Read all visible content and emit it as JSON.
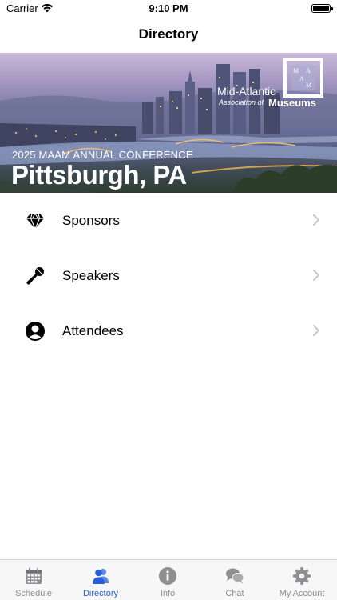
{
  "status_bar": {
    "carrier": "Carrier",
    "time": "9:10 PM",
    "battery_level": 1.0
  },
  "nav": {
    "title": "Directory"
  },
  "banner": {
    "conference": "2025 MAAM ANNUAL CONFERENCE",
    "city": "Pittsburgh, PA",
    "logo_letters": [
      "M",
      "A",
      "A",
      "M"
    ],
    "org_line1": "Mid-Atlantic",
    "org_line2": "Association of",
    "org_line3": "Museums"
  },
  "list": {
    "items": [
      {
        "label": "Sponsors",
        "icon": "diamond-icon"
      },
      {
        "label": "Speakers",
        "icon": "microphone-icon"
      },
      {
        "label": "Attendees",
        "icon": "user-circle-icon"
      }
    ]
  },
  "tabs": {
    "items": [
      {
        "label": "Schedule",
        "icon": "calendar-icon",
        "active": false
      },
      {
        "label": "Directory",
        "icon": "people-icon",
        "active": true
      },
      {
        "label": "Info",
        "icon": "info-icon",
        "active": false
      },
      {
        "label": "Chat",
        "icon": "chat-bubbles-icon",
        "active": false
      },
      {
        "label": "My Account",
        "icon": "gear-icon",
        "active": false
      }
    ]
  },
  "colors": {
    "tab_active": "#2a5fd6",
    "tab_inactive": "#8e8e93",
    "chevron": "#c7c7cc"
  }
}
